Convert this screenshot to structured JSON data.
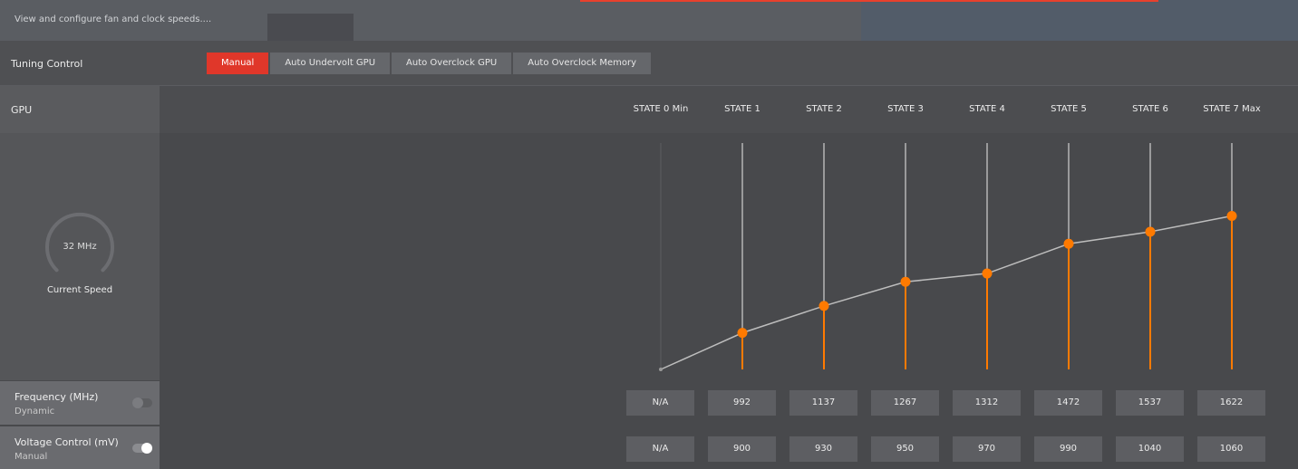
{
  "header": {
    "description": "View and configure fan and clock speeds...."
  },
  "tuning_control": {
    "label": "Tuning Control",
    "tabs": [
      {
        "label": "Manual",
        "active": true
      },
      {
        "label": "Auto Undervolt GPU",
        "active": false
      },
      {
        "label": "Auto Overclock GPU",
        "active": false
      },
      {
        "label": "Auto Overclock Memory",
        "active": false
      }
    ]
  },
  "gpu": {
    "label": "GPU",
    "gauge": {
      "value": "32 MHz",
      "caption": "Current Speed",
      "level": 0
    }
  },
  "states": [
    {
      "label": "STATE 0 Min",
      "frequency": "N/A",
      "voltage": "N/A"
    },
    {
      "label": "STATE 1",
      "frequency": "992",
      "voltage": "900"
    },
    {
      "label": "STATE 2",
      "frequency": "1137",
      "voltage": "930"
    },
    {
      "label": "STATE 3",
      "frequency": "1267",
      "voltage": "950"
    },
    {
      "label": "STATE 4",
      "frequency": "1312",
      "voltage": "970"
    },
    {
      "label": "STATE 5",
      "frequency": "1472",
      "voltage": "990"
    },
    {
      "label": "STATE 6",
      "frequency": "1537",
      "voltage": "1040"
    },
    {
      "label": "STATE 7 Max",
      "frequency": "1622",
      "voltage": "1060"
    }
  ],
  "controls": {
    "frequency": {
      "title": "Frequency (MHz)",
      "mode": "Dynamic",
      "toggle_on": false
    },
    "voltage": {
      "title": "Voltage Control (mV)",
      "mode": "Manual",
      "toggle_on": true
    }
  },
  "colors": {
    "accent_red": "#e0372a",
    "curve_orange": "#ff7a00",
    "rail": "#b5b5b5",
    "line": "#bdbdbd"
  }
}
